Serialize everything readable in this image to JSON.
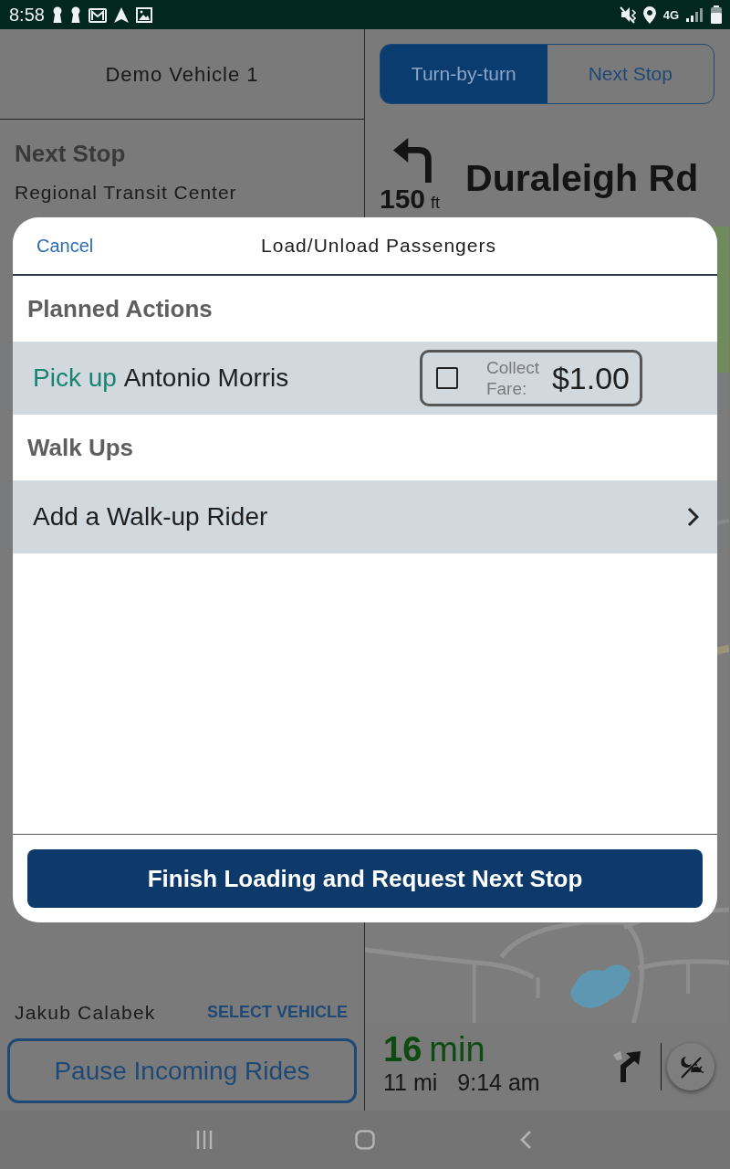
{
  "status_bar": {
    "time": "8:58",
    "network": "4G"
  },
  "left_panel": {
    "vehicle": "Demo Vehicle 1",
    "next_stop_heading": "Next Stop",
    "next_stop": "Regional Transit Center",
    "driver": "Jakub Calabek",
    "select_vehicle": "SELECT VEHICLE",
    "pause_button": "Pause Incoming Rides"
  },
  "right_panel": {
    "tabs": [
      {
        "label": "Turn-by-turn",
        "selected": true
      },
      {
        "label": "Next Stop",
        "selected": false
      }
    ],
    "maneuver": {
      "distance": "150",
      "unit": "ft",
      "street": "Duraleigh Rd"
    },
    "trip": {
      "duration": "16",
      "duration_unit": "min",
      "distance": "11 mi",
      "arrival": "9:14 am"
    }
  },
  "dialog": {
    "cancel": "Cancel",
    "title": "Load/Unload Passengers",
    "sections": [
      {
        "heading": "Planned Actions",
        "rows": [
          {
            "kind": "pickup",
            "action": "Pick up",
            "rider": "Antonio Morris",
            "fare_checked": false,
            "fare_label": "Collect Fare:",
            "fare_amount": "$1.00"
          }
        ]
      },
      {
        "heading": "Walk Ups",
        "rows": [
          {
            "kind": "link",
            "label": "Add a Walk-up Rider"
          }
        ]
      }
    ],
    "finish_button": "Finish Loading and Request Next Stop"
  }
}
